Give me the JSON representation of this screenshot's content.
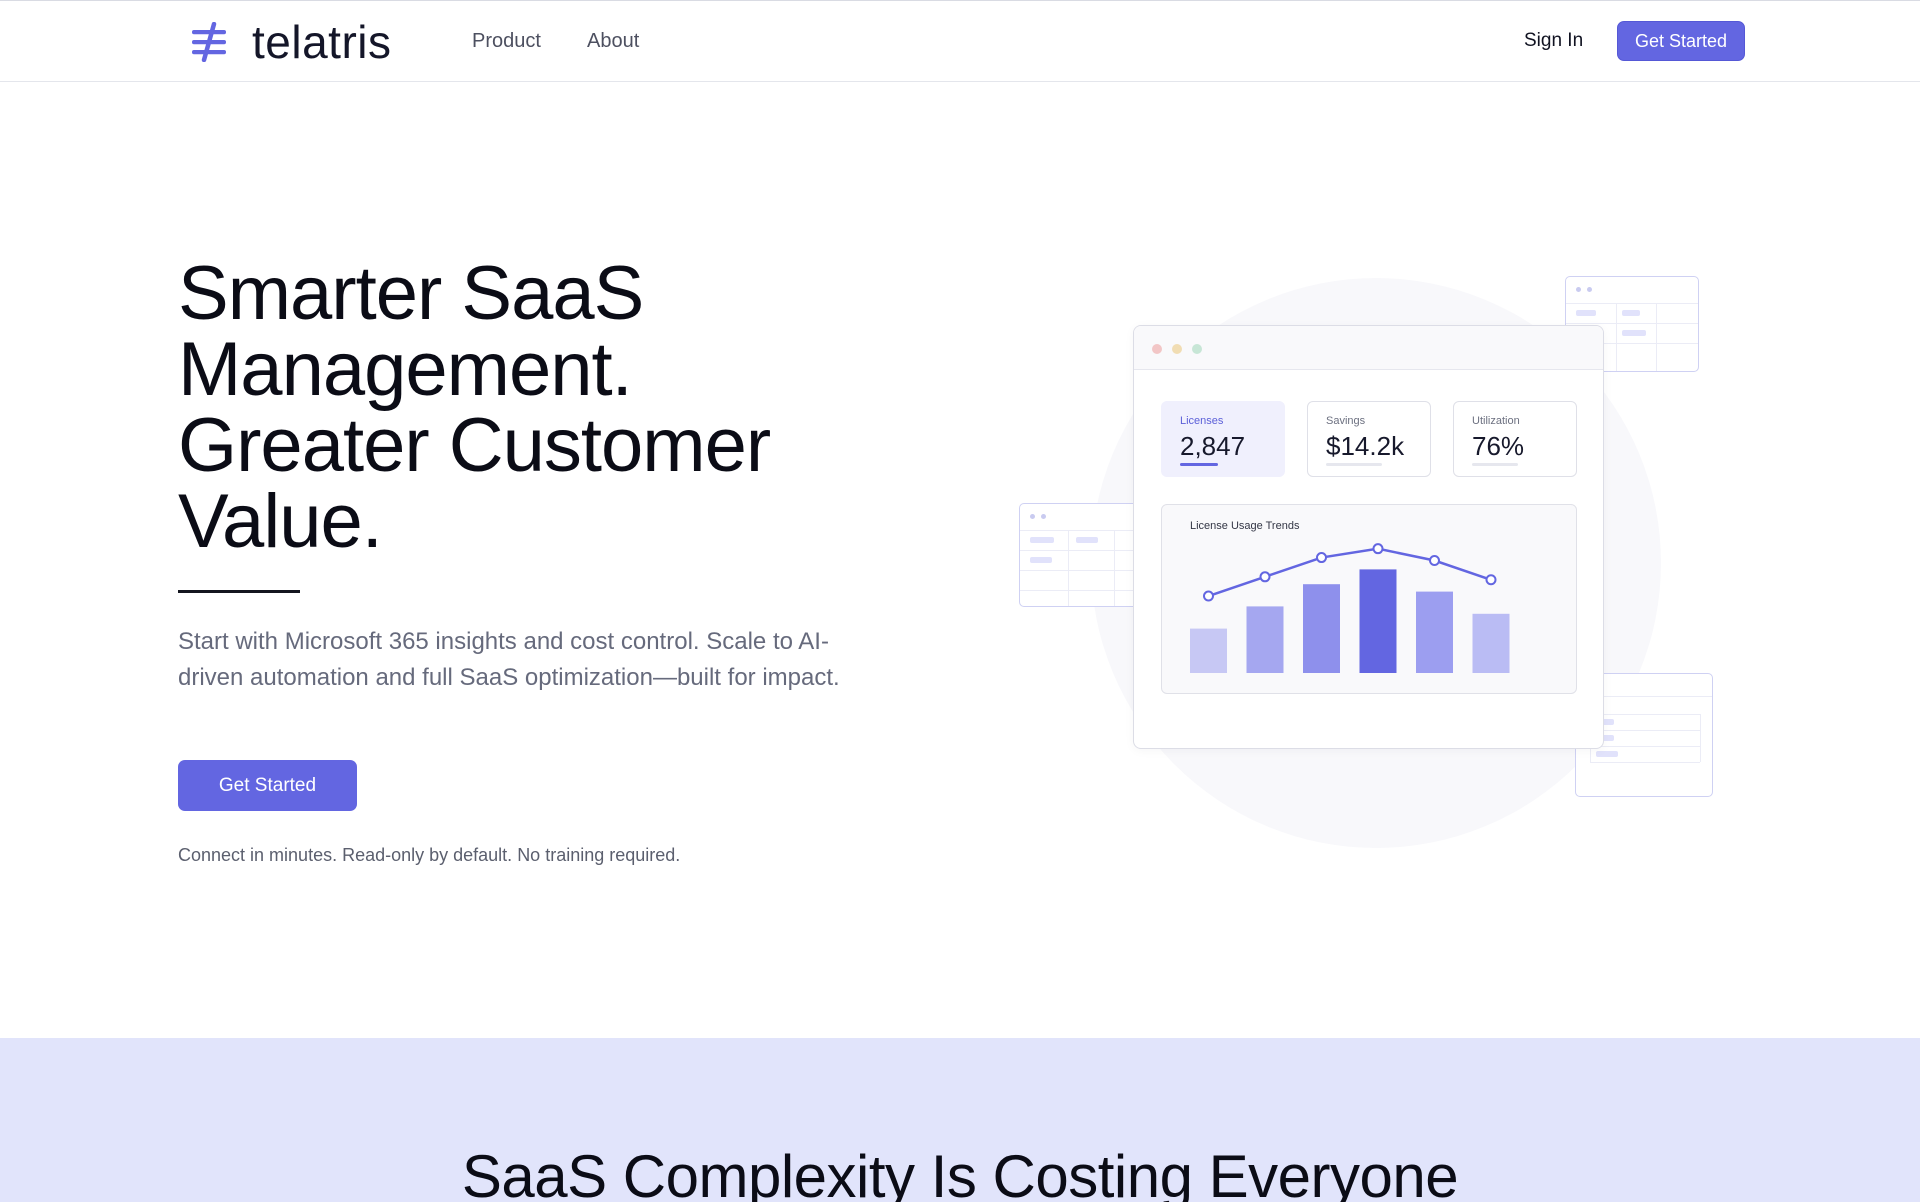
{
  "nav": {
    "logo_text": "telatris",
    "links": [
      "Product",
      "About"
    ],
    "sign_in": "Sign In",
    "cta": "Get Started",
    "accent_color": "#6366e1"
  },
  "hero": {
    "title_lines": [
      "Smarter SaaS",
      "Management.",
      "Greater Customer",
      "Value."
    ],
    "subtitle": "Start with Microsoft 365 insights and cost control. Scale to AI-driven automation and full SaaS optimization—built for impact.",
    "cta": "Get Started",
    "note": "Connect in minutes. Read-only by default. No training required."
  },
  "dashboard": {
    "stats": [
      {
        "label": "Licenses",
        "value": "2,847"
      },
      {
        "label": "Savings",
        "value": "$14.2k"
      },
      {
        "label": "Utilization",
        "value": "76%"
      }
    ],
    "chart_title": "License Usage Trends"
  },
  "chart_data": {
    "type": "bar",
    "title": "License Usage Trends",
    "bar_values": [
      30,
      45,
      60,
      70,
      55,
      40
    ],
    "line_values": [
      52,
      65,
      78,
      84,
      76,
      63
    ],
    "ylim": [
      0,
      100
    ],
    "bar_colors": [
      "#c7c8f4",
      "#a5a7f0",
      "#8e90ec",
      "#6366e1",
      "#9c9ef0",
      "#babcf4"
    ],
    "line_color": "#6366e1"
  },
  "section": {
    "heading": "SaaS Complexity Is Costing Everyone",
    "background": "#e1e4fb"
  }
}
